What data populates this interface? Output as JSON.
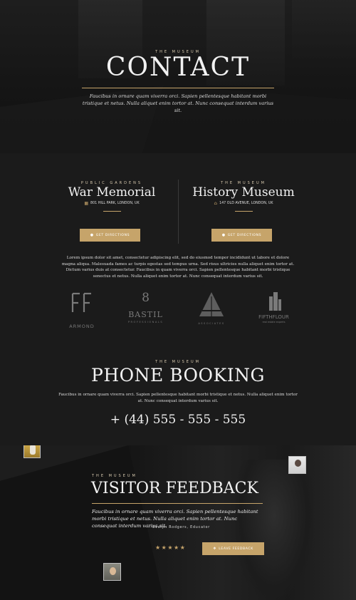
{
  "hero": {
    "eyebrow": "THE MUSEUM",
    "title": "CONTACT",
    "description": "Faucibus in ornare quam viverra orci. Sapien pellentesque habitant morbi tristique et netus. Nulla aliquet enim tortor at. Nunc consequat interdum varius sit."
  },
  "locations": [
    {
      "eyebrow": "PUBLIC GARDENS",
      "name": "War Memorial",
      "address": "801 HILL PARK, LONDON, UK",
      "icon": "map-icon",
      "button": "GET DIRECTIONS"
    },
    {
      "eyebrow": "THE MUSEUM",
      "name": "History Museum",
      "address": "147 OLD AVENUE, LONDON, UK",
      "icon": "home-icon",
      "button": "GET DIRECTIONS"
    }
  ],
  "intro": "Lorem ipsum dolor sit amet, consectetur adipiscing elit, sed do eiusmod tempor incididunt ut labore et dolore magna aliqua. Malesuada fames ac turpis egestas sed tempus urna. Sed risus ultricies nulla aliquet enim tortor at. Dictum varius duis at consectetur. Faucibus in quam viverra orci. Sapien pellentesque habitant morbi tristique senectus et netus. Nulla aliquet enim tortor at. Nunc consequat interdum varius sit.",
  "logos": [
    {
      "name": "ARMOND",
      "sub": ""
    },
    {
      "name": "BASTIL",
      "sub": "PROFESSIONALS"
    },
    {
      "name": "",
      "sub": "ASSOCIATES"
    },
    {
      "name": "FIFTHFLOUR",
      "sub": "real estate experts"
    }
  ],
  "phone": {
    "eyebrow": "THE MUSEUM",
    "title": "PHONE BOOKING",
    "description": "Faucibus in ornare quam viverra orci. Sapien pellentesque habitant morbi tristique et netus. Nulla aliquet enim tortor at. Nunc consequat interdum varius sit.",
    "number": "+ (44) 555 - 555 - 555"
  },
  "feedback": {
    "eyebrow": "THE MUSEUM",
    "title": "VISITOR FEEDBACK",
    "quote": "Faucibus in ornare quam viverra orci. Sapien pellentesque habitant morbi tristique et netus. Nulla aliquet enim tortor at. Nunc consequat interdum varius sit.",
    "author": "— Evelyn Rodgers, Educator",
    "stars": "★★★★★",
    "rating": 5,
    "button": "LEAVE FEEDBACK"
  },
  "colors": {
    "accent": "#c6a46a",
    "background": "#1b1b1b"
  }
}
